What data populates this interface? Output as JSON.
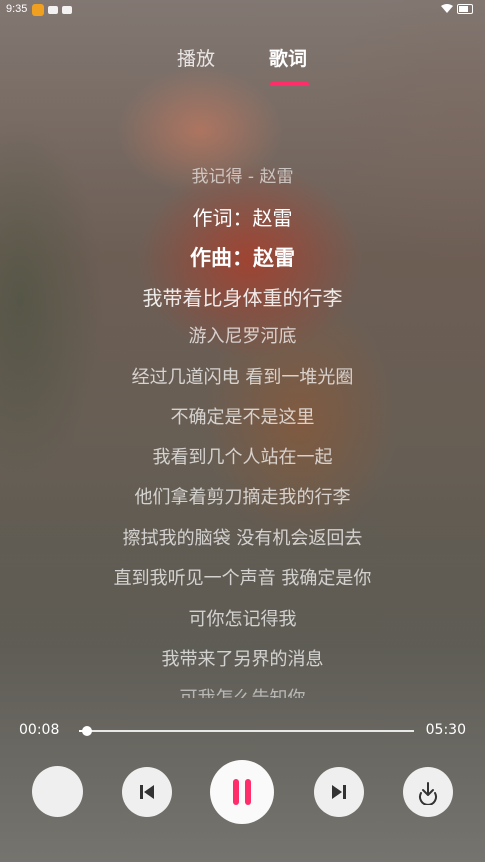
{
  "status_bar": {
    "time": "9:35"
  },
  "tabs": [
    {
      "label": "播放",
      "active": false
    },
    {
      "label": "歌词",
      "active": true
    }
  ],
  "accent_color": "#ff2d6a",
  "lyrics": [
    {
      "text": "我记得 - 赵雷",
      "style": "header"
    },
    {
      "text": "作词：赵雷",
      "style": "highlight"
    },
    {
      "text": "作曲：赵雷",
      "style": "current"
    },
    {
      "text": "我带着比身体重的行李",
      "style": "near"
    },
    {
      "text": "游入尼罗河底",
      "style": "normal"
    },
    {
      "text": "经过几道闪电 看到一堆光圈",
      "style": "normal"
    },
    {
      "text": "不确定是不是这里",
      "style": "normal"
    },
    {
      "text": "我看到几个人站在一起",
      "style": "normal"
    },
    {
      "text": "他们拿着剪刀摘走我的行李",
      "style": "normal"
    },
    {
      "text": "擦拭我的脑袋 没有机会返回去",
      "style": "normal"
    },
    {
      "text": "直到我听见一个声音 我确定是你",
      "style": "normal"
    },
    {
      "text": "可你怎记得我",
      "style": "normal"
    },
    {
      "text": "我带来了另界的消息",
      "style": "normal"
    },
    {
      "text": "可我怎么告知你",
      "style": "cut"
    }
  ],
  "player": {
    "current_time": "00:08",
    "total_time": "05:30",
    "progress_fraction": 0.024
  },
  "controls": {
    "cover_icon": "album-cover",
    "prev_icon": "skip-previous-icon",
    "play_pause_icon": "pause-icon",
    "next_icon": "skip-next-icon",
    "download_icon": "download-icon"
  }
}
